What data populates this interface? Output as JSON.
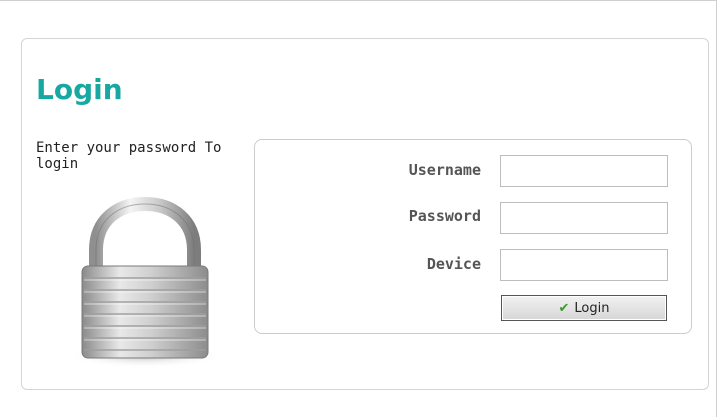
{
  "page": {
    "title": "Login",
    "description": "Enter your password To login"
  },
  "form": {
    "username_label": "Username",
    "password_label": "Password",
    "device_label": "Device",
    "username_value": "",
    "password_value": "",
    "device_value": "",
    "login_label": "Login"
  },
  "icons": {
    "lock": "padlock-icon",
    "check": "checkmark-icon"
  },
  "colors": {
    "title": "#17a8a2",
    "check": "#3a9a2c"
  }
}
